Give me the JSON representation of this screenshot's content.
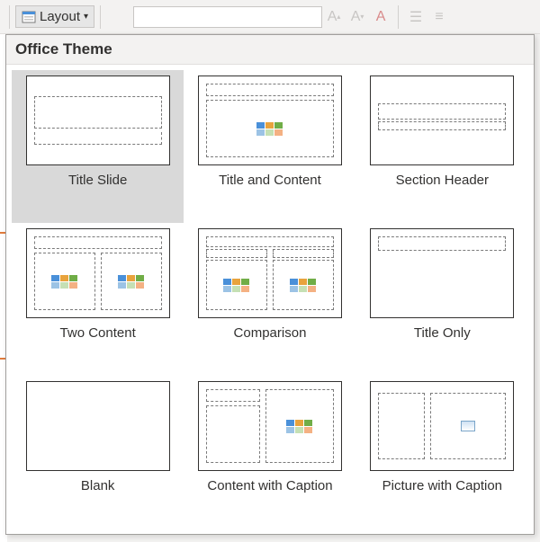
{
  "ribbon": {
    "layout_label": "Layout"
  },
  "panel": {
    "header": "Office Theme",
    "layouts": [
      {
        "label": "Title Slide"
      },
      {
        "label": "Title and Content"
      },
      {
        "label": "Section Header"
      },
      {
        "label": "Two Content"
      },
      {
        "label": "Comparison"
      },
      {
        "label": "Title Only"
      },
      {
        "label": "Blank"
      },
      {
        "label": "Content with Caption"
      },
      {
        "label": "Picture with Caption"
      }
    ]
  }
}
